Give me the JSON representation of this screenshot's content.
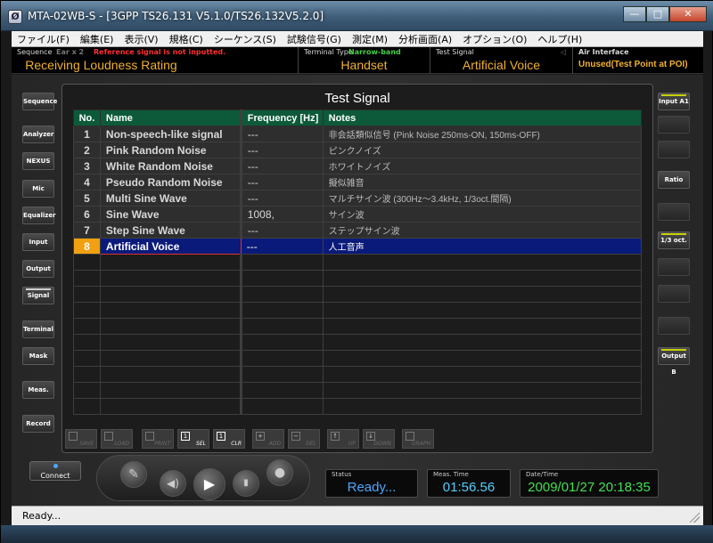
{
  "window": {
    "app_icon_glyph": "Ø",
    "title": "MTA-02WB-S - [3GPP TS26.131 V5.1.0/TS26.132V5.2.0]",
    "controls": {
      "minimize": "—",
      "maximize": "□",
      "close": "✕"
    }
  },
  "menu": [
    "ファイル(F)",
    "編集(E)",
    "表示(V)",
    "規格(C)",
    "シーケンス(S)",
    "試験信号(G)",
    "測定(M)",
    "分析画面(A)",
    "オプション(O)",
    "ヘルプ(H)"
  ],
  "info": {
    "sequence": {
      "label": "Sequence",
      "ear": "Ear x 2",
      "warning": "Reference signal is not inputted.",
      "value": "Receiving Loudness Rating"
    },
    "terminal": {
      "label": "Terminal Type",
      "band": "Narrow-band",
      "value": "Handset"
    },
    "signal": {
      "label": "Test Signal",
      "value": "Artificial Voice"
    },
    "air": {
      "label": "Air Interface",
      "value": "Unused(Test Point at POI)"
    }
  },
  "left_buttons": [
    "Sequence",
    "Analyzer",
    "NEXUS",
    "Mic",
    "Equalizer",
    "Input",
    "Output",
    "Signal",
    "Terminal",
    "Mask",
    "Meas.",
    "Record"
  ],
  "right_buttons": [
    "Input A1",
    "",
    "",
    "Ratio",
    "",
    "1/3 oct.",
    "",
    "",
    "",
    "Output B"
  ],
  "panel": {
    "title": "Test Signal",
    "columns": [
      "No.",
      "Name",
      "Frequency [Hz]",
      "Notes"
    ],
    "rows": [
      {
        "no": "1",
        "name": "Non-speech-like signal",
        "freq": "---",
        "notes": "非会話類似信号 (Pink Noise 250ms-ON, 150ms-OFF)"
      },
      {
        "no": "2",
        "name": "Pink Random Noise",
        "freq": "---",
        "notes": "ピンクノイズ"
      },
      {
        "no": "3",
        "name": "White Random Noise",
        "freq": "---",
        "notes": "ホワイトノイズ"
      },
      {
        "no": "4",
        "name": "Pseudo Random Noise",
        "freq": "---",
        "notes": "擬似雑音"
      },
      {
        "no": "5",
        "name": "Multi Sine Wave",
        "freq": "---",
        "notes": "マルチサイン波 (300Hz～3.4kHz, 1/3oct.間隔)"
      },
      {
        "no": "6",
        "name": "Sine Wave",
        "freq": "1008,",
        "notes": "サイン波"
      },
      {
        "no": "7",
        "name": "Step Sine Wave",
        "freq": "---",
        "notes": "ステップサイン波"
      },
      {
        "no": "8",
        "name": "Artificial Voice",
        "freq": "---",
        "notes": "人工音声"
      }
    ],
    "selected_row": 8
  },
  "toolbar": [
    {
      "label": "SAVE",
      "glyph": ""
    },
    {
      "label": "LOAD",
      "glyph": ""
    },
    {
      "label": "PRINT",
      "glyph": ""
    },
    {
      "label": "SEL",
      "glyph": "1"
    },
    {
      "label": "CLR",
      "glyph": "1"
    },
    {
      "label": "ADD",
      "glyph": "+"
    },
    {
      "label": "DEL",
      "glyph": "−"
    },
    {
      "label": "UP",
      "glyph": "↑"
    },
    {
      "label": "DOWN",
      "glyph": "↓"
    },
    {
      "label": "GRAPH",
      "glyph": ""
    }
  ],
  "bottom": {
    "connect": "Connect",
    "status": {
      "label": "Status",
      "value": "Ready..."
    },
    "meas_time": {
      "label": "Meas. Time",
      "value": "01:56.56"
    },
    "datetime": {
      "label": "Date/Time",
      "value": "2009/01/27 20:18:35"
    }
  },
  "statusbar": "Ready...",
  "colors": {
    "accent_orange": "#f0b030",
    "header_green": "#0d5a3a",
    "selected_blue": "#0a1a7a",
    "selected_no": "#f0a010"
  }
}
